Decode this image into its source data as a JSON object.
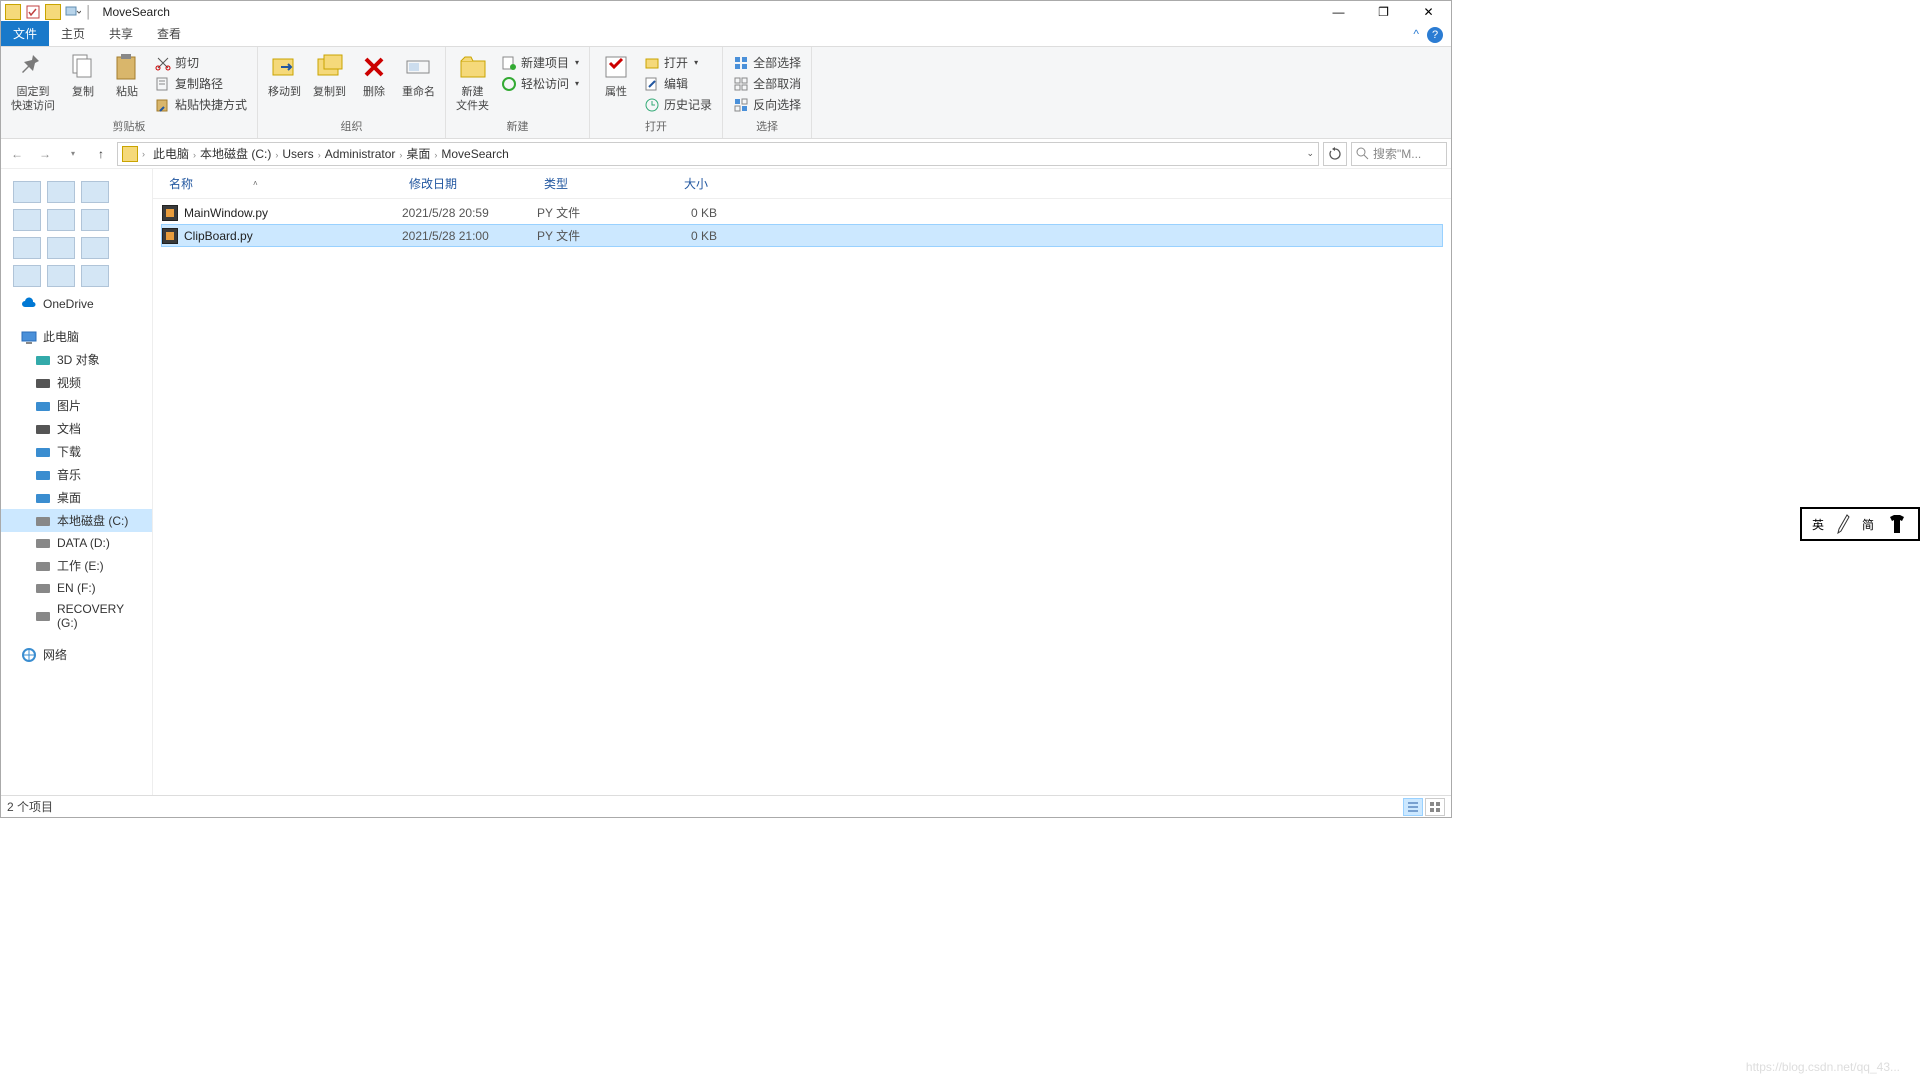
{
  "window": {
    "title": "MoveSearch",
    "min_tip": "—",
    "max_tip": "❐",
    "close_tip": "✕"
  },
  "ribbon": {
    "tabs": {
      "file": "文件",
      "home": "主页",
      "share": "共享",
      "view": "查看"
    },
    "collapse_tip": "^",
    "help_tip": "?",
    "clipboard": {
      "pin": "固定到\n快速访问",
      "copy": "复制",
      "paste": "粘贴",
      "cut": "剪切",
      "copy_path": "复制路径",
      "paste_shortcut": "粘贴快捷方式",
      "label": "剪贴板"
    },
    "organize": {
      "move_to": "移动到",
      "copy_to": "复制到",
      "delete": "删除",
      "rename": "重命名",
      "label": "组织"
    },
    "new": {
      "new_folder": "新建\n文件夹",
      "new_item": "新建项目",
      "easy_access": "轻松访问",
      "label": "新建"
    },
    "open": {
      "properties": "属性",
      "open": "打开",
      "edit": "编辑",
      "history": "历史记录",
      "label": "打开"
    },
    "select": {
      "select_all": "全部选择",
      "select_none": "全部取消",
      "invert": "反向选择",
      "label": "选择"
    }
  },
  "breadcrumbs": [
    "此电脑",
    "本地磁盘 (C:)",
    "Users",
    "Administrator",
    "桌面",
    "MoveSearch"
  ],
  "search_placeholder": "搜索\"M...",
  "columns": {
    "name": "名称",
    "date": "修改日期",
    "type": "类型",
    "size": "大小"
  },
  "files": [
    {
      "name": "MainWindow.py",
      "date": "2021/5/28 20:59",
      "type": "PY 文件",
      "size": "0 KB",
      "selected": false
    },
    {
      "name": "ClipBoard.py",
      "date": "2021/5/28 21:00",
      "type": "PY 文件",
      "size": "0 KB",
      "selected": true
    }
  ],
  "navpane": {
    "onedrive": "OneDrive",
    "this_pc": "此电脑",
    "items": [
      {
        "label": "3D 对象",
        "key": "3d"
      },
      {
        "label": "视频",
        "key": "videos"
      },
      {
        "label": "图片",
        "key": "pictures"
      },
      {
        "label": "文档",
        "key": "documents"
      },
      {
        "label": "下载",
        "key": "downloads"
      },
      {
        "label": "音乐",
        "key": "music"
      },
      {
        "label": "桌面",
        "key": "desktop"
      },
      {
        "label": "本地磁盘 (C:)",
        "key": "c",
        "selected": true
      },
      {
        "label": "DATA (D:)",
        "key": "d"
      },
      {
        "label": "工作 (E:)",
        "key": "e"
      },
      {
        "label": "EN (F:)",
        "key": "f"
      },
      {
        "label": "RECOVERY (G:)",
        "key": "g"
      }
    ],
    "network": "网络"
  },
  "statusbar": {
    "item_count": "2 个项目"
  },
  "ime": {
    "left": "英",
    "right": "简"
  },
  "watermark": "https://blog.csdn.net/qq_43..."
}
